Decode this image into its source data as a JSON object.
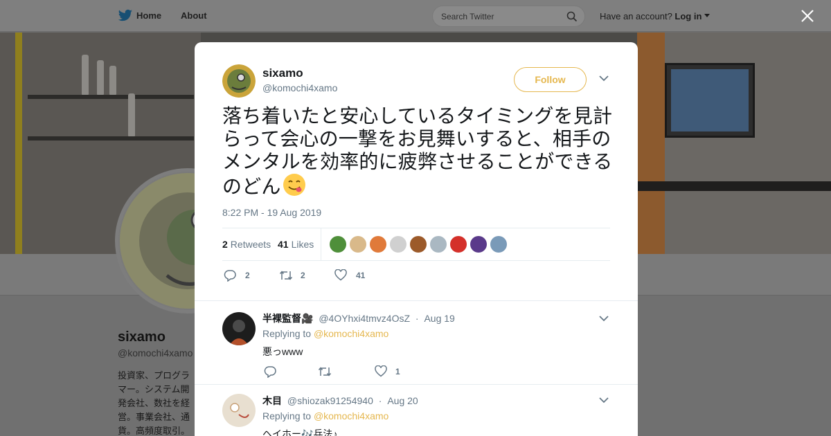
{
  "header": {
    "nav": [
      {
        "label": "Home"
      },
      {
        "label": "About"
      }
    ],
    "search_placeholder": "Search Twitter",
    "account_prompt": "Have an account?",
    "login_label": "Log in"
  },
  "profile": {
    "name": "sixamo",
    "handle": "@komochi4xamo",
    "bio": "投資家、プログラマー。システム開発会社、数社を経営。事業会社、通貨。高頻度取引。FreqMagic/自動売"
  },
  "tweet": {
    "author_name": "sixamo",
    "author_handle": "@komochi4xamo",
    "follow_label": "Follow",
    "text": "落ち着いたと安心しているタイミングを見計らって会心の一撃をお見舞いすると、相手のメンタルを効率的に疲弊させることができるのどん",
    "timestamp": "8:22 PM - 19 Aug 2019",
    "retweets_count": "2",
    "retweets_label": "Retweets",
    "likes_count": "41",
    "likes_label": "Likes",
    "actions": {
      "reply_count": "2",
      "retweet_count": "2",
      "like_count": "41"
    }
  },
  "replies": [
    {
      "name": "半裸監督🎥",
      "handle": "@4OYhxi4tmvz4OsZ",
      "date": "Aug 19",
      "replying_prefix": "Replying to",
      "replying_to": "@komochi4xamo",
      "text": "悪っwww",
      "like_count": "1"
    },
    {
      "name": "木目",
      "handle": "@shiozak91254940",
      "date": "Aug 20",
      "replying_prefix": "Replying to",
      "replying_to": "@komochi4xamo",
      "text": "ヘイホー🎶兵法♪"
    }
  ],
  "colors": {
    "accent": "#e5b74e",
    "twitter_blue": "#1da1f2",
    "secondary_text": "#657786"
  }
}
